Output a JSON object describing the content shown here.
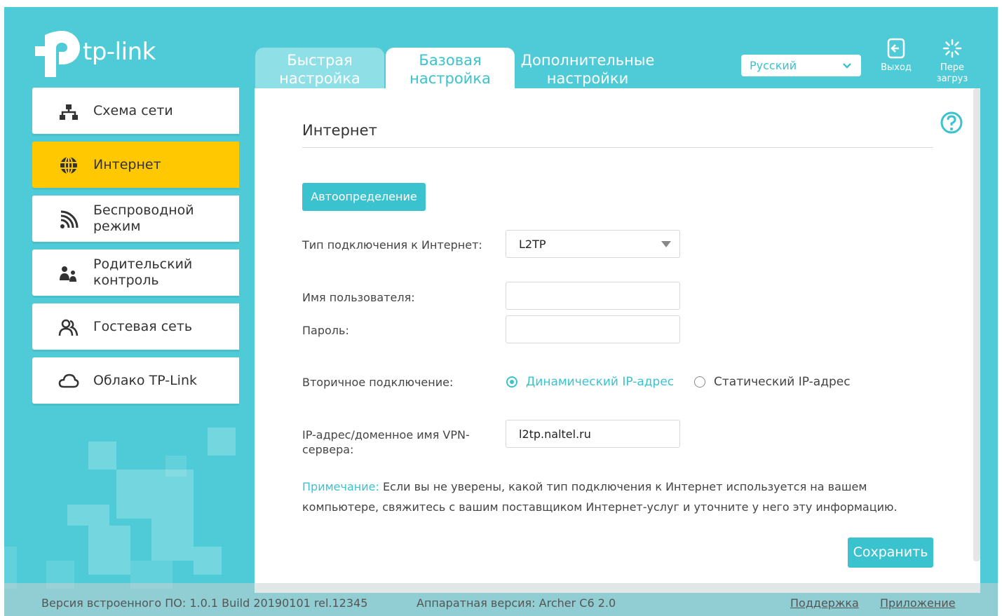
{
  "brand": {
    "logo_text": "tp-link"
  },
  "tabs": {
    "quick": "Быстрая настройка",
    "basic": "Базовая настройка",
    "advanced": "Дополнительные настройки"
  },
  "header": {
    "language": "Русский",
    "logout_label": "Выход",
    "reboot_label": "Пере загруз"
  },
  "sidebar": {
    "items": [
      {
        "label": "Схема сети",
        "icon": "network-map-icon"
      },
      {
        "label": "Интернет",
        "icon": "globe-icon",
        "active": true
      },
      {
        "label": "Беспроводной режим",
        "icon": "wireless-icon"
      },
      {
        "label": "Родительский контроль",
        "icon": "parental-control-icon"
      },
      {
        "label": "Гостевая сеть",
        "icon": "guest-network-icon"
      },
      {
        "label": "Облако TP-Link",
        "icon": "cloud-icon"
      }
    ]
  },
  "main": {
    "title": "Интернет",
    "auto_detect_label": "Автоопределение",
    "connection_type_label": "Тип подключения к Интернет:",
    "connection_type_value": "L2TP",
    "username_label": "Имя пользователя:",
    "username_value": "",
    "password_label": "Пароль:",
    "password_value": "",
    "secondary_label": "Вторичное подключение:",
    "secondary_options": [
      "Динамический IP-адрес",
      "Статический IP-адрес"
    ],
    "secondary_selected": "Динамический IP-адрес",
    "vpn_label": "IP-адрес/доменное имя VPN-сервера:",
    "vpn_value": "l2tp.naltel.ru",
    "note_label": "Примечание:",
    "note_text": "Если вы не уверены, какой тип подключения к Интернет используется на вашем компьютере, свяжитесь с вашим поставщиком Интернет-услуг и уточните у него эту информацию.",
    "save_label": "Сохранить"
  },
  "footer": {
    "firmware": "Версия встроенного ПО: 1.0.1 Build 20190101 rel.12345",
    "hardware": "Аппаратная версия: Archer C6 2.0",
    "support_link": "Поддержка",
    "app_link": "Приложение"
  },
  "colors": {
    "accent": "#3ac3cf",
    "background": "#4ecbd6",
    "active_menu": "#ffc800"
  }
}
